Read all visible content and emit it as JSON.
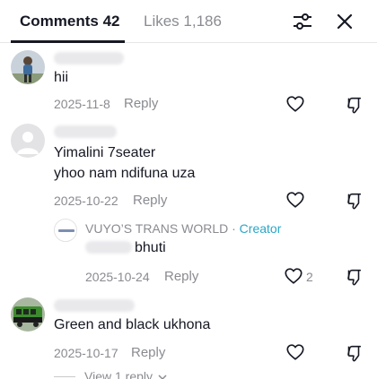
{
  "header": {
    "comments_tab": "Comments 42",
    "likes_tab": "Likes 1,186",
    "filter_icon": "filter-sliders-icon",
    "close_icon": "close-icon"
  },
  "comments": [
    {
      "text": "hii",
      "date": "2025-11-8",
      "reply": "Reply"
    },
    {
      "text_line1": "Yimalini 7seater",
      "text_line2": "yhoo nam ndifuna uza",
      "date": "2025-10-22",
      "reply": "Reply"
    },
    {
      "reply_author": "VUYO’S TRANS WORLD",
      "separator": "·",
      "creator_badge": "Creator",
      "text": "bhuti",
      "date": "2025-10-24",
      "reply": "Reply",
      "like_count": "2"
    },
    {
      "text": "Green and black ukhona",
      "date": "2025-10-17",
      "reply": "Reply",
      "view_replies": "View 1 reply"
    }
  ],
  "colors": {
    "text": "#161823",
    "muted": "#8a8b91",
    "creator": "#2aa6c7"
  }
}
